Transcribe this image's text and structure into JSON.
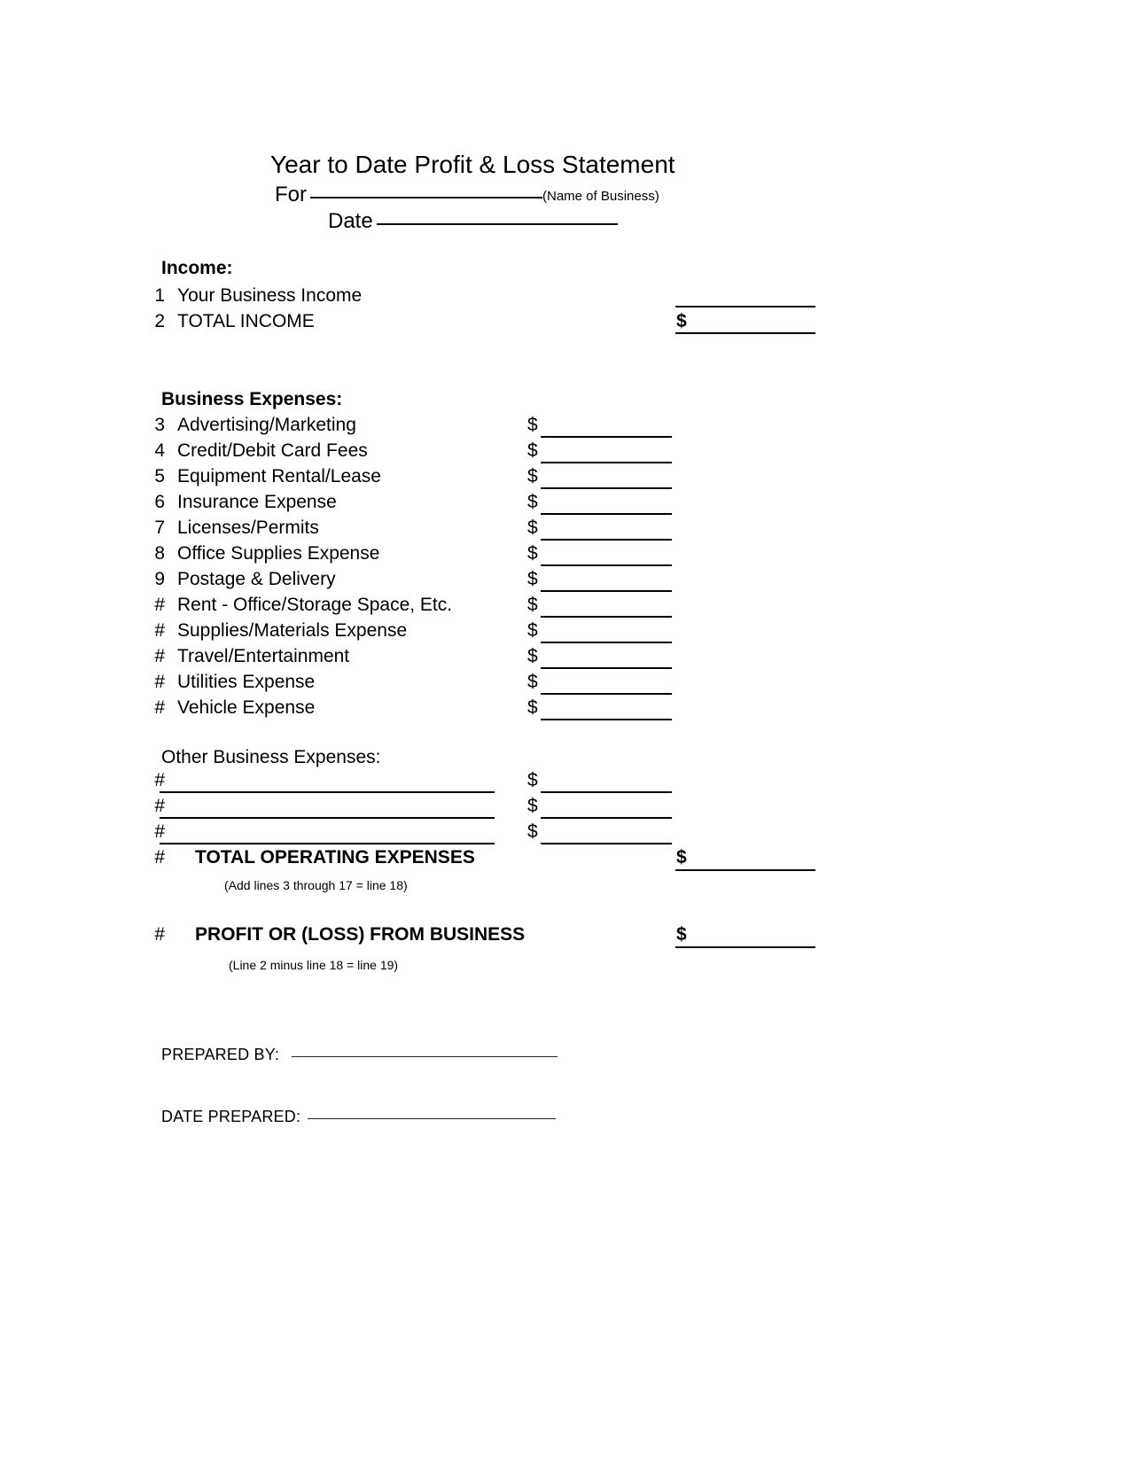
{
  "document": {
    "title": "Year to Date Profit & Loss Statement",
    "for_label": "For",
    "name_of_business_hint": "(Name of Business)",
    "date_label": "Date"
  },
  "income": {
    "heading": "Income:",
    "rows": [
      {
        "num": "1",
        "label": "Your Business Income",
        "dollar": ""
      },
      {
        "num": "2",
        "label": "TOTAL INCOME",
        "dollar": "$"
      }
    ]
  },
  "expenses": {
    "heading": "Business Expenses:",
    "dollar_symbol": "$",
    "rows": [
      {
        "num": "3",
        "label": "Advertising/Marketing"
      },
      {
        "num": "4",
        "label": "Credit/Debit Card Fees"
      },
      {
        "num": "5",
        "label": "Equipment Rental/Lease"
      },
      {
        "num": "6",
        "label": "Insurance Expense"
      },
      {
        "num": "7",
        "label": "Licenses/Permits"
      },
      {
        "num": "8",
        "label": "Office Supplies Expense"
      },
      {
        "num": "9",
        "label": "Postage & Delivery"
      },
      {
        "num": "#",
        "label": "Rent - Office/Storage Space, Etc."
      },
      {
        "num": "#",
        "label": "Supplies/Materials Expense"
      },
      {
        "num": "#",
        "label": "Travel/Entertainment"
      },
      {
        "num": "#",
        "label": "Utilities Expense"
      },
      {
        "num": "#",
        "label": "Vehicle Expense"
      }
    ]
  },
  "other_expenses": {
    "heading": "Other Business Expenses:",
    "dollar_symbol": "$",
    "rows": [
      {
        "num": "#",
        "label": ""
      },
      {
        "num": "#",
        "label": ""
      },
      {
        "num": "#",
        "label": ""
      }
    ]
  },
  "totals": {
    "operating": {
      "num": "#",
      "label": "TOTAL OPERATING EXPENSES",
      "dollar": "$",
      "note": "(Add lines 3 through 17 = line 18)"
    },
    "profit": {
      "num": "#",
      "label": "PROFIT OR (LOSS) FROM BUSINESS",
      "dollar": "$",
      "note": "(Line 2 minus line 18 = line 19)"
    }
  },
  "footer": {
    "prepared_by_label": "PREPARED BY:",
    "date_prepared_label": "DATE PREPARED:"
  }
}
